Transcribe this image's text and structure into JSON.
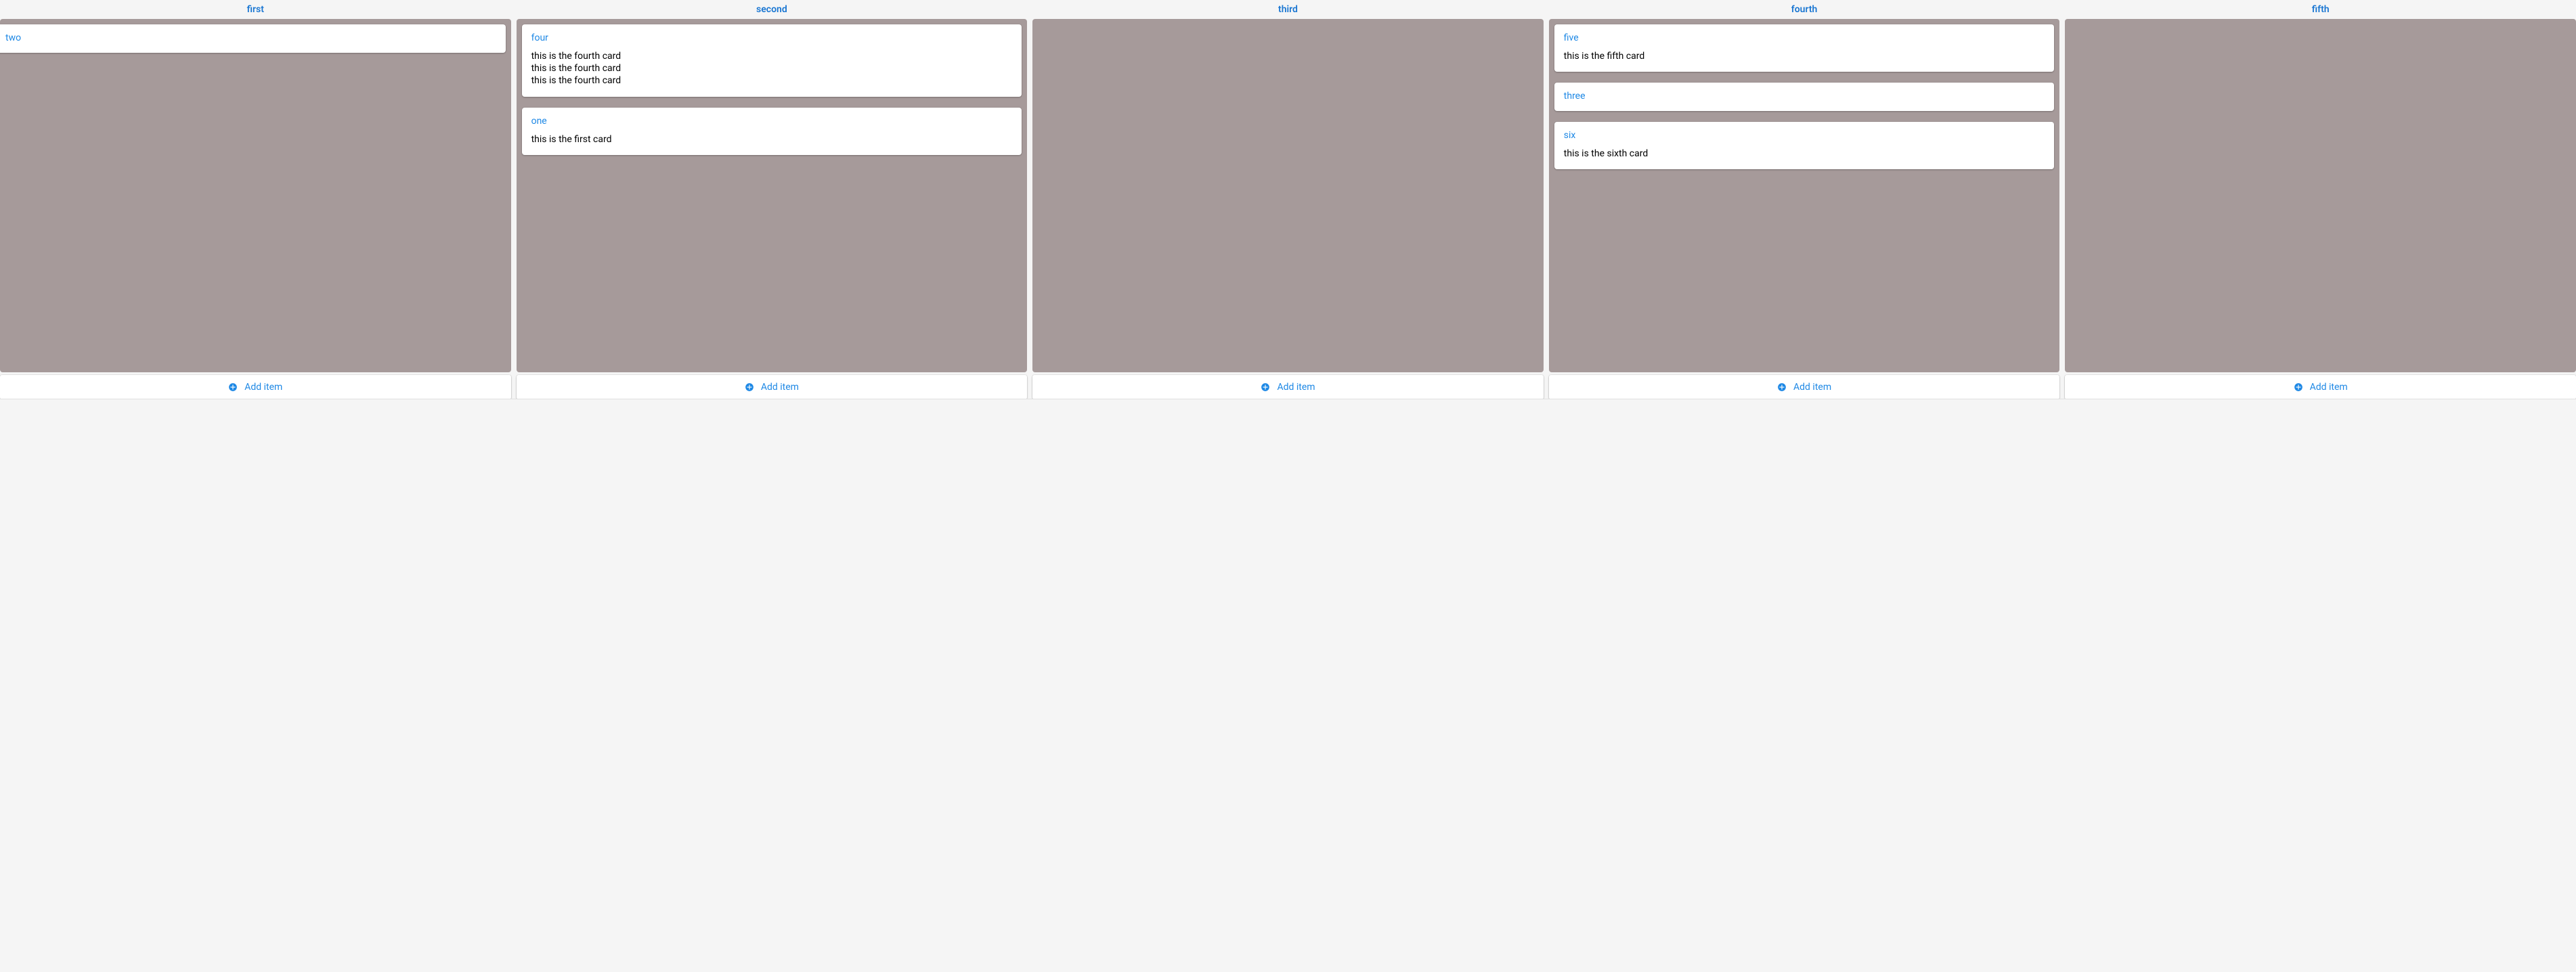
{
  "colors": {
    "accent": "#1e88e5",
    "header_accent": "#1976d2",
    "column_bg": "#a69a9a",
    "page_bg": "#f5f5f5",
    "card_bg": "#ffffff"
  },
  "add_item_label": "Add item",
  "columns": [
    {
      "id": "first",
      "title": "first",
      "cards": [
        {
          "id": "two",
          "title": "two",
          "body": "",
          "offset_left": true
        }
      ]
    },
    {
      "id": "second",
      "title": "second",
      "cards": [
        {
          "id": "four",
          "title": "four",
          "body": "this is the fourth card\nthis is the fourth card\nthis is the fourth card"
        },
        {
          "id": "one",
          "title": "one",
          "body": "this is the first card"
        }
      ]
    },
    {
      "id": "third",
      "title": "third",
      "cards": []
    },
    {
      "id": "fourth",
      "title": "fourth",
      "cards": [
        {
          "id": "five",
          "title": "five",
          "body": "this is the fifth card"
        },
        {
          "id": "three",
          "title": "three",
          "body": ""
        },
        {
          "id": "six",
          "title": "six",
          "body": "this is the sixth card"
        }
      ]
    },
    {
      "id": "fifth",
      "title": "fifth",
      "cards": []
    }
  ]
}
